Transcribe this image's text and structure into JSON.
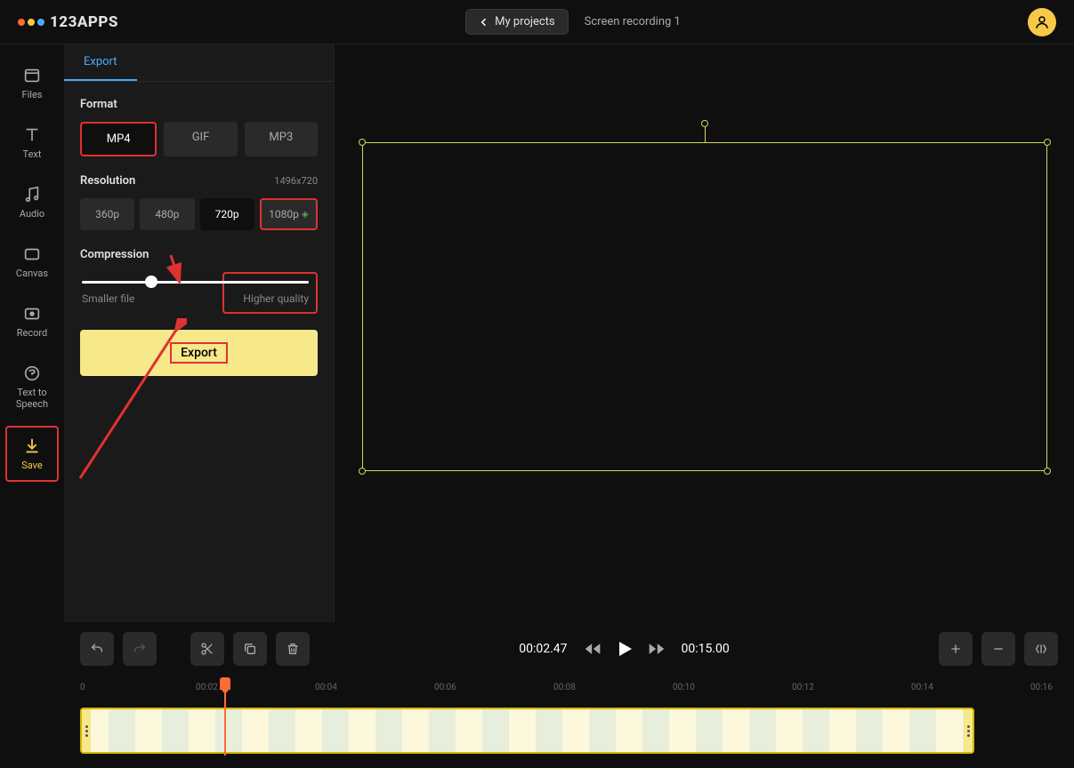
{
  "header": {
    "logo_text": "123APPS",
    "my_projects_label": "My projects",
    "project_name": "Screen recording 1"
  },
  "sidebar": {
    "items": [
      {
        "label": "Files",
        "icon": "files-icon"
      },
      {
        "label": "Text",
        "icon": "text-icon"
      },
      {
        "label": "Audio",
        "icon": "audio-icon"
      },
      {
        "label": "Canvas",
        "icon": "canvas-icon"
      },
      {
        "label": "Record",
        "icon": "record-icon"
      },
      {
        "label": "Text to Speech",
        "icon": "tts-icon"
      },
      {
        "label": "Save",
        "icon": "save-icon"
      }
    ]
  },
  "panel": {
    "tab_label": "Export",
    "format": {
      "label": "Format",
      "options": [
        "MP4",
        "GIF",
        "MP3"
      ],
      "selected": "MP4"
    },
    "resolution": {
      "label": "Resolution",
      "size_text": "1496x720",
      "options": [
        "360p",
        "480p",
        "720p",
        "1080p"
      ],
      "selected": "720p",
      "premium_option": "1080p"
    },
    "compression": {
      "label": "Compression",
      "min_label": "Smaller file",
      "max_label": "Higher quality",
      "slider_percent": 28
    },
    "export_button_label": "Export"
  },
  "playback": {
    "current_time": "00:02.47",
    "total_time": "00:15.00"
  },
  "timeline": {
    "start_label": "0",
    "marks": [
      "00:02",
      "00:04",
      "00:06",
      "00:08",
      "00:10",
      "00:12",
      "00:14",
      "00:16"
    ]
  },
  "annotations": {
    "highlight_color": "#e03131"
  }
}
